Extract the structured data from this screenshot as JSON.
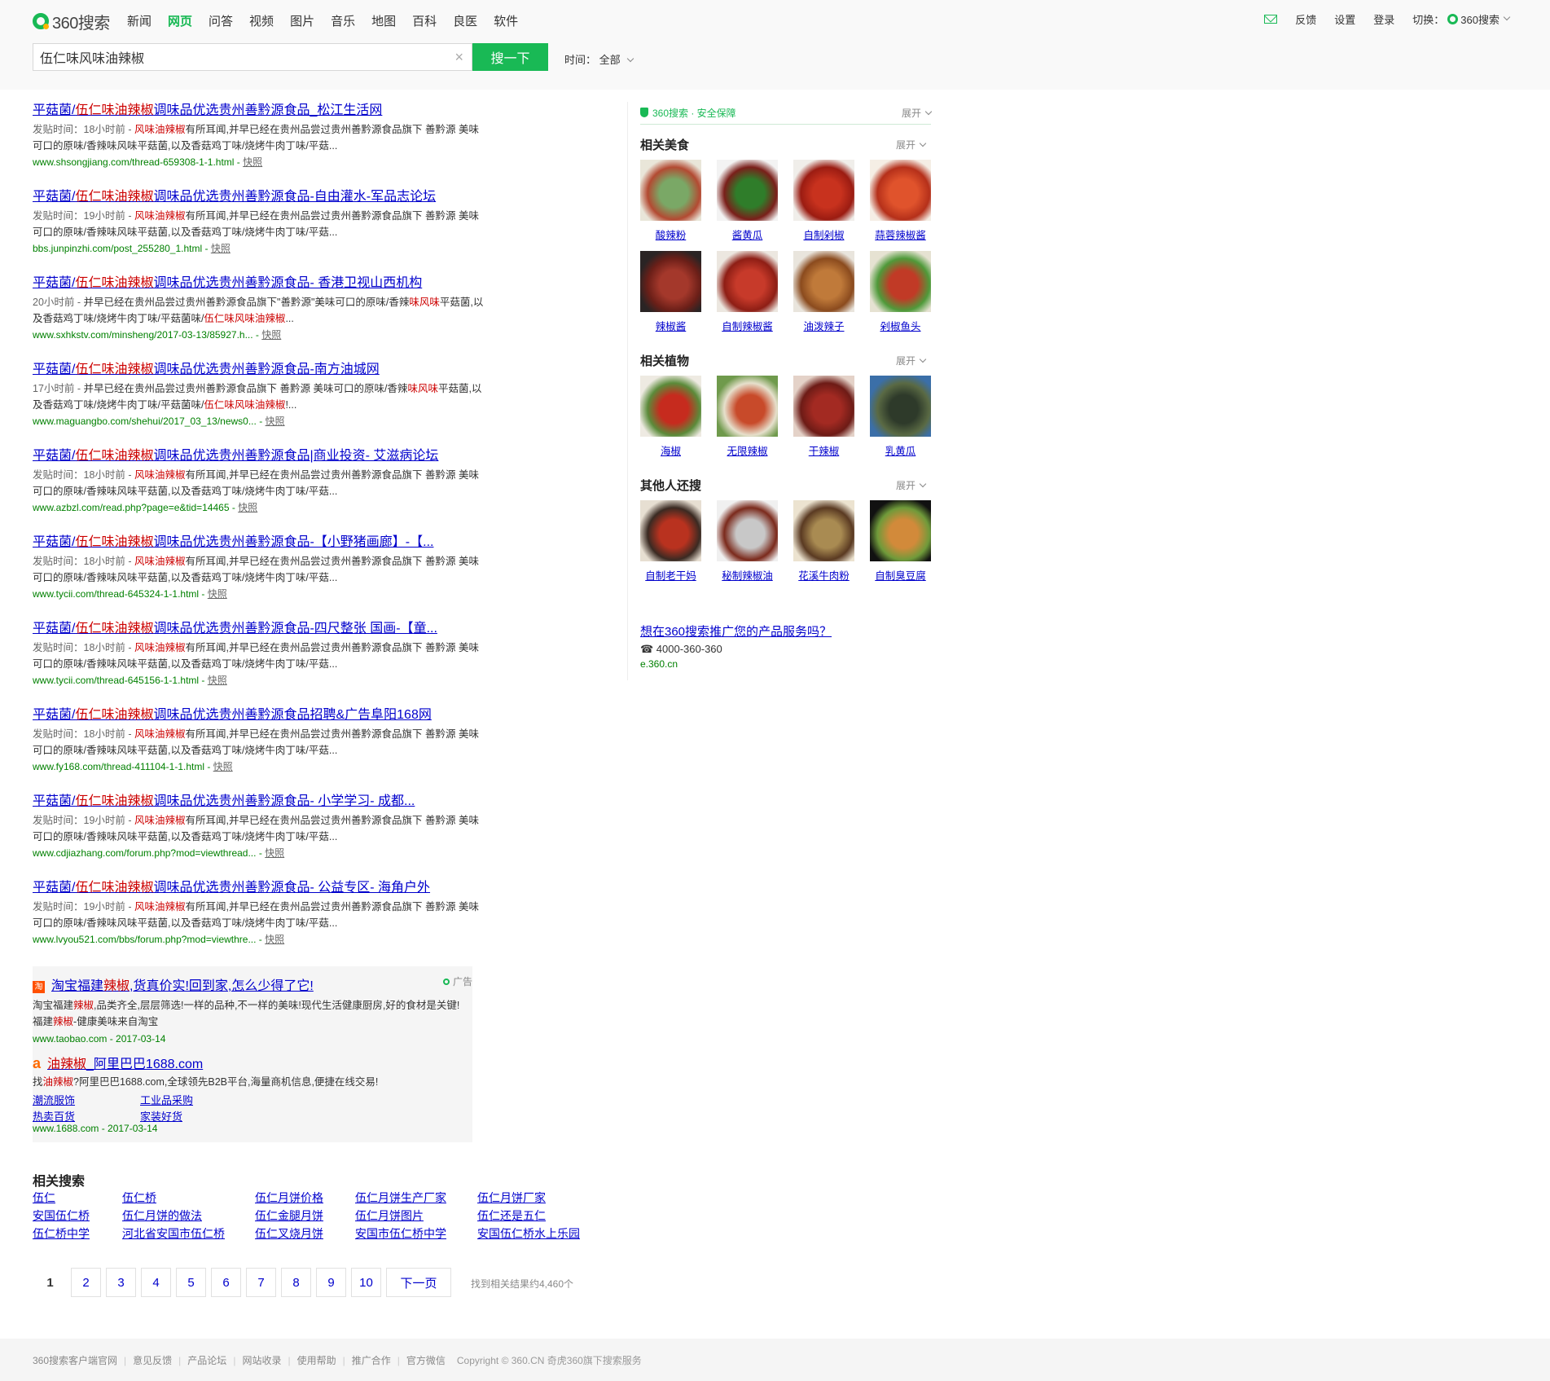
{
  "header": {
    "logo_text": "360搜索",
    "nav": [
      "新闻",
      "网页",
      "问答",
      "视频",
      "图片",
      "音乐",
      "地图",
      "百科",
      "良医",
      "软件"
    ],
    "nav_active_index": 1,
    "top_right": {
      "feedback": "反馈",
      "settings": "设置",
      "login": "登录",
      "switch_label": "切换：",
      "switch_value": "360搜索"
    },
    "search": {
      "query": "伍仁味风味油辣椒",
      "button": "搜一下"
    },
    "time_filter": {
      "label": "时间：",
      "value": "全部"
    }
  },
  "results": [
    {
      "title_pre": "平菇菌/",
      "title_em": "伍仁味油辣椒",
      "title_post": "调味品优选贵州善黔源食品_松江生活网",
      "time": "发贴时间：18小时前 - ",
      "desc_em": "风味油辣椒",
      "desc": "有所耳闻,并早已经在贵州品尝过贵州善黔源食品旗下 善黔源 美味可口的原味/香辣味风味平菇菌,以及香菇鸡丁味/烧烤牛肉丁味/平菇...",
      "url": "www.shsongjiang.com/thread-659308-1-1.html",
      "snap": "快照"
    },
    {
      "title_pre": "平菇菌/",
      "title_em": "伍仁味油辣椒",
      "title_post": "调味品优选贵州善黔源食品-自由灌水-军品志论坛",
      "time": "发贴时间：19小时前 - ",
      "desc_em": "风味油辣椒",
      "desc": "有所耳闻,并早已经在贵州品尝过贵州善黔源食品旗下 善黔源 美味可口的原味/香辣味风味平菇菌,以及香菇鸡丁味/烧烤牛肉丁味/平菇...",
      "url": "bbs.junpinzhi.com/post_255280_1.html",
      "snap": "快照"
    },
    {
      "title_pre": "平菇菌/",
      "title_em": "伍仁味油辣椒",
      "title_post": "调味品优选贵州善黔源食品- 香港卫视山西机构",
      "time": "20小时前 - ",
      "desc_a": "并早已经在贵州品尝过贵州善黔源食品旗下\"善黔源\"美味可口的原味/香辣",
      "desc_em1": "味风味",
      "desc_b": "平菇菌,以及香菇鸡丁味/烧烤牛肉丁味/平菇菌味/",
      "desc_em2": "伍仁味风味油辣椒",
      "desc_c": "...",
      "url": "www.sxhkstv.com/minsheng/2017-03-13/85927.h...",
      "snap": "快照"
    },
    {
      "title_pre": "平菇菌/",
      "title_em": "伍仁味油辣椒",
      "title_post": "调味品优选贵州善黔源食品-南方油城网",
      "time": "17小时前 - ",
      "desc_a": "并早已经在贵州品尝过贵州善黔源食品旗下 善黔源 美味可口的原味/香辣",
      "desc_em1": "味风味",
      "desc_b": "平菇菌,以及香菇鸡丁味/烧烤牛肉丁味/平菇菌味/",
      "desc_em2": "伍仁味风味油辣椒",
      "desc_c": "!...",
      "url": "www.maguangbo.com/shehui/2017_03_13/news0...",
      "snap": "快照"
    },
    {
      "title_pre": "平菇菌/",
      "title_em": "伍仁味油辣椒",
      "title_post": "调味品优选贵州善黔源食品|商业投资- 艾滋病论坛",
      "time": "发贴时间：18小时前 - ",
      "desc_em": "风味油辣椒",
      "desc": "有所耳闻,并早已经在贵州品尝过贵州善黔源食品旗下 善黔源 美味可口的原味/香辣味风味平菇菌,以及香菇鸡丁味/烧烤牛肉丁味/平菇...",
      "url": "www.azbzl.com/read.php?page=e&tid=14465",
      "snap": "快照"
    },
    {
      "title_pre": "平菇菌/",
      "title_em": "伍仁味油辣椒",
      "title_post": "调味品优选贵州善黔源食品-【小野猪画廊】-【...",
      "time": "发贴时间：18小时前 - ",
      "desc_em": "风味油辣椒",
      "desc": "有所耳闻,并早已经在贵州品尝过贵州善黔源食品旗下 善黔源 美味可口的原味/香辣味风味平菇菌,以及香菇鸡丁味/烧烤牛肉丁味/平菇...",
      "url": "www.tycii.com/thread-645324-1-1.html",
      "snap": "快照"
    },
    {
      "title_pre": "平菇菌/",
      "title_em": "伍仁味油辣椒",
      "title_post": "调味品优选贵州善黔源食品-四尺整张 国画-【童...",
      "time": "发贴时间：18小时前 - ",
      "desc_em": "风味油辣椒",
      "desc": "有所耳闻,并早已经在贵州品尝过贵州善黔源食品旗下 善黔源 美味可口的原味/香辣味风味平菇菌,以及香菇鸡丁味/烧烤牛肉丁味/平菇...",
      "url": "www.tycii.com/thread-645156-1-1.html",
      "snap": "快照"
    },
    {
      "title_pre": "平菇菌/",
      "title_em": "伍仁味油辣椒",
      "title_post": "调味品优选贵州善黔源食品招聘&广告阜阳168网",
      "time": "发贴时间：18小时前 - ",
      "desc_em": "风味油辣椒",
      "desc": "有所耳闻,并早已经在贵州品尝过贵州善黔源食品旗下 善黔源 美味可口的原味/香辣味风味平菇菌,以及香菇鸡丁味/烧烤牛肉丁味/平菇...",
      "url": "www.fy168.com/thread-411104-1-1.html",
      "snap": "快照"
    },
    {
      "title_pre": "平菇菌/",
      "title_em": "伍仁味油辣椒",
      "title_post": "调味品优选贵州善黔源食品- 小学学习- 成都...",
      "time": "发贴时间：19小时前 - ",
      "desc_em": "风味油辣椒",
      "desc": "有所耳闻,并早已经在贵州品尝过贵州善黔源食品旗下 善黔源 美味可口的原味/香辣味风味平菇菌,以及香菇鸡丁味/烧烤牛肉丁味/平菇...",
      "url": "www.cdjiazhang.com/forum.php?mod=viewthread...",
      "snap": "快照"
    },
    {
      "title_pre": "平菇菌/",
      "title_em": "伍仁味油辣椒",
      "title_post": "调味品优选贵州善黔源食品- 公益专区- 海角户外",
      "time": "发贴时间：19小时前 - ",
      "desc_em": "风味油辣椒",
      "desc": "有所耳闻,并早已经在贵州品尝过贵州善黔源食品旗下 善黔源 美味可口的原味/香辣味风味平菇菌,以及香菇鸡丁味/烧烤牛肉丁味/平菇...",
      "url": "www.lvyou521.com/bbs/forum.php?mod=viewthre...",
      "snap": "快照"
    }
  ],
  "ads": {
    "tag": "广告",
    "taobao": {
      "icon": "淘",
      "title_a": "淘宝福建",
      "title_em": "辣椒",
      "title_b": ",货真价实!回到家,怎么少得了它!",
      "desc_a": "淘宝福建",
      "desc_em1": "辣椒",
      "desc_b": ",品类齐全,层层筛选!一样的品种,不一样的美味!现代生活健康厨房,好的食材是关键!福建",
      "desc_em2": "辣椒",
      "desc_c": "-健康美味来自淘宝",
      "url": "www.taobao.com - 2017-03-14"
    },
    "alibaba": {
      "icon": "a",
      "title_em": "油辣椒",
      "title_b": "_阿里巴巴1688.com",
      "desc_a": "找",
      "desc_em": "油辣椒",
      "desc_b": "?阿里巴巴1688.com,全球领先B2B平台,海量商机信息,便捷在线交易!",
      "links": [
        "潮流服饰",
        "工业品采购",
        "热卖百货",
        "家装好货"
      ],
      "url": "www.1688.com - 2017-03-14"
    }
  },
  "related": {
    "heading": "相关搜索",
    "rows": [
      [
        "伍仁",
        "伍仁桥",
        "伍仁月饼价格",
        "伍仁月饼生产厂家",
        "伍仁月饼厂家"
      ],
      [
        "安国伍仁桥",
        "伍仁月饼的做法",
        "伍仁金腿月饼",
        "伍仁月饼图片",
        "伍仁还是五仁"
      ],
      [
        "伍仁桥中学",
        "河北省安国市伍仁桥",
        "伍仁叉烧月饼",
        "安国市伍仁桥中学",
        "安国伍仁桥水上乐园"
      ]
    ]
  },
  "pager": {
    "pages": [
      "1",
      "2",
      "3",
      "4",
      "5",
      "6",
      "7",
      "8",
      "9",
      "10"
    ],
    "current": 1,
    "next": "下一页",
    "count": "找到相关结果约4,460个"
  },
  "side": {
    "safe": "360搜索 · 安全保障",
    "expand": "展开",
    "sections": [
      {
        "heading": "相关美食",
        "items": [
          {
            "label": "酸辣粉",
            "colors": [
              "#e9e6d9",
              "#7aa866",
              "#b34a32"
            ]
          },
          {
            "label": "酱黄瓜",
            "colors": [
              "#f3f3f3",
              "#2f7d2a",
              "#7a1f1a"
            ]
          },
          {
            "label": "自制剁椒",
            "colors": [
              "#f0eeea",
              "#c8321e",
              "#9b1c12"
            ]
          },
          {
            "label": "蒜蓉辣椒酱",
            "colors": [
              "#f5eee5",
              "#e0532c",
              "#b5301a"
            ]
          },
          {
            "label": "辣椒酱",
            "colors": [
              "#2a2424",
              "#a4382b",
              "#6b1f18"
            ]
          },
          {
            "label": "自制辣椒酱",
            "colors": [
              "#ece7e0",
              "#c73a2a",
              "#8e1e15"
            ]
          },
          {
            "label": "油泼辣子",
            "colors": [
              "#e9e5dd",
              "#c07a3a",
              "#8b4b1e"
            ]
          },
          {
            "label": "剁椒鱼头",
            "colors": [
              "#e6e2d2",
              "#c13a26",
              "#4f9a3a"
            ]
          }
        ]
      },
      {
        "heading": "相关植物",
        "items": [
          {
            "label": "海椒",
            "colors": [
              "#eeeae2",
              "#c62b1e",
              "#5b8b3a"
            ]
          },
          {
            "label": "无限辣椒",
            "colors": [
              "#6f9a4c",
              "#c84a2a",
              "#e6e0cc"
            ]
          },
          {
            "label": "干辣椒",
            "colors": [
              "#e4d2c8",
              "#a32a22",
              "#6d1b16"
            ]
          },
          {
            "label": "乳黄瓜",
            "colors": [
              "#3b6fa8",
              "#2e3a2a",
              "#5a6a44"
            ]
          }
        ]
      },
      {
        "heading": "其他人还搜",
        "items": [
          {
            "label": "自制老干妈",
            "colors": [
              "#e7dfd2",
              "#b9321f",
              "#3a2a22"
            ]
          },
          {
            "label": "秘制辣椒油",
            "colors": [
              "#f0f0f0",
              "#c8c8c8",
              "#7b2a1c"
            ]
          },
          {
            "label": "花溪牛肉粉",
            "colors": [
              "#ece3d0",
              "#a98b52",
              "#5a3a22"
            ]
          },
          {
            "label": "自制臭豆腐",
            "colors": [
              "#111111",
              "#d28a3a",
              "#6f9a3a"
            ]
          }
        ]
      }
    ],
    "promo": {
      "link": "想在360搜索推广您的产品服务吗？",
      "phone": "☎ 4000-360-360",
      "url": "e.360.cn"
    }
  },
  "footer": {
    "links": [
      "360搜索客户端官网",
      "意见反馈",
      "产品论坛",
      "网站收录",
      "使用帮助",
      "推广合作",
      "官方微信"
    ],
    "copyright": "Copyright © 360.CN 奇虎360旗下搜索服务"
  },
  "colors": {
    "brand": "#19b955",
    "link": "#0000cc",
    "highlight": "#cc0000",
    "url": "#008000"
  }
}
